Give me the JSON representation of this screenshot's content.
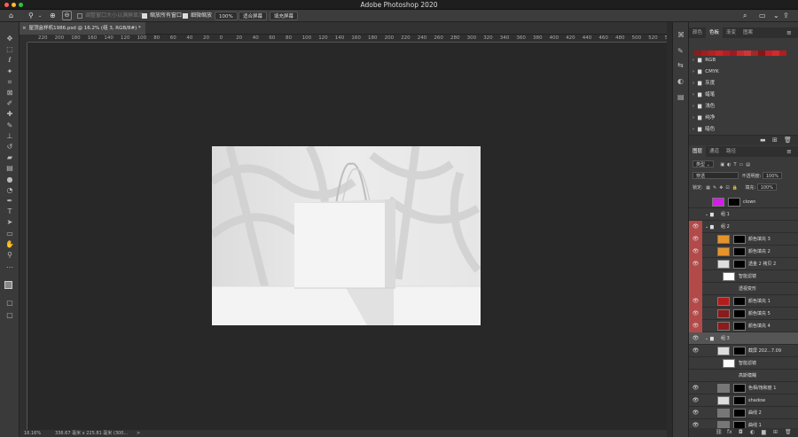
{
  "app": {
    "title": "Adobe Photoshop 2020"
  },
  "options": {
    "resize_label": "调整窗口大小以满屏显示",
    "zoom_all_label": "缩放所有窗口",
    "scrubby_label": "细微缩放",
    "zoom_value": "100%",
    "fit_screen": "适合屏幕",
    "fill_screen": "填充屏幕"
  },
  "document": {
    "tab_label": "屋顶盒样机1986.psd @ 16.2% (组 3, RGB/8#) *"
  },
  "ruler": {
    "h_ticks": [
      "220",
      "200",
      "180",
      "160",
      "140",
      "120",
      "100",
      "80",
      "60",
      "40",
      "20",
      "0",
      "20",
      "40",
      "60",
      "80",
      "100",
      "120",
      "140",
      "160",
      "180",
      "200",
      "220",
      "240",
      "260",
      "280",
      "300",
      "320",
      "340",
      "360",
      "380",
      "400",
      "420",
      "440",
      "460",
      "480",
      "500",
      "520",
      "540",
      "560"
    ]
  },
  "status": {
    "zoom": "16.16%",
    "size": "336.67 毫米 x 225.81 毫米 (300...",
    "arrow": ">"
  },
  "colors": {
    "accent_red": "#b34a4a",
    "bg": "#2b2b2b",
    "panel": "#3a3a3a"
  },
  "swatches_panel": {
    "tabs": [
      "颜色",
      "色板",
      "渐变",
      "图案"
    ],
    "active_tab": "色板",
    "swatch_colors": [
      "#8c1b1b",
      "#a11e1e",
      "#b52020",
      "#c92424",
      "#b81c26",
      "#9e1a22",
      "#c42b2b",
      "#d13636",
      "#a12828",
      "#8a1414",
      "#c61f2a",
      "#d22a2a",
      "#b01e1e"
    ],
    "folders": [
      "RGB",
      "CMYK",
      "灰度",
      "蜡笔",
      "浅色",
      "纯净",
      "暗色"
    ]
  },
  "layers_panel": {
    "tabs": [
      "图层",
      "通道",
      "路径"
    ],
    "active_tab": "图层",
    "kind_label": "类型",
    "blend_mode": "穿透",
    "opacity_label": "不透明度:",
    "opacity_value": "100%",
    "lock_label": "锁定:",
    "fill_label": "填充:",
    "fill_value": "100%",
    "layers": [
      {
        "name": "clown",
        "type": "color",
        "swatch": "#d21ee8",
        "red": false,
        "eye": false,
        "indent": 0
      },
      {
        "name": "组 1",
        "type": "group",
        "red": false,
        "eye": false,
        "indent": 0
      },
      {
        "name": "组 2",
        "type": "group",
        "red": true,
        "eye": true,
        "indent": 0
      },
      {
        "name": "颜色填充 3",
        "type": "fill",
        "swatch": "#e8932a",
        "red": true,
        "eye": true,
        "indent": 1
      },
      {
        "name": "颜色填充 2",
        "type": "fill",
        "swatch": "#e8932a",
        "red": true,
        "eye": true,
        "indent": 1
      },
      {
        "name": "透金 2 拷贝 2",
        "type": "smart",
        "red": true,
        "eye": true,
        "indent": 1
      },
      {
        "name": "智能滤镜",
        "type": "filter",
        "red": true,
        "eye": false,
        "indent": 2
      },
      {
        "name": "透视变形",
        "type": "subfilter",
        "red": true,
        "eye": false,
        "indent": 2
      },
      {
        "name": "颜色填充 1",
        "type": "fill",
        "swatch": "#b41c1c",
        "red": true,
        "eye": true,
        "indent": 1
      },
      {
        "name": "颜色填充 5",
        "type": "fill",
        "swatch": "#8c1b1b",
        "red": true,
        "eye": true,
        "indent": 1
      },
      {
        "name": "颜色填充 4",
        "type": "fill",
        "swatch": "#8c1b1b",
        "red": true,
        "eye": true,
        "indent": 1
      },
      {
        "name": "组 3",
        "type": "group",
        "red": false,
        "eye": true,
        "indent": 0,
        "selected": true
      },
      {
        "name": "截屏 202...7.09",
        "type": "smart",
        "red": false,
        "eye": true,
        "indent": 1
      },
      {
        "name": "智能滤镜",
        "type": "filter",
        "red": false,
        "eye": false,
        "indent": 2
      },
      {
        "name": "高斯模糊",
        "type": "subfilter",
        "red": false,
        "eye": false,
        "indent": 2
      },
      {
        "name": "色相/饱和度 1",
        "type": "adjust",
        "red": false,
        "eye": true,
        "indent": 1
      },
      {
        "name": "shadow",
        "type": "pixel",
        "red": false,
        "eye": true,
        "indent": 1
      },
      {
        "name": "曲线 2",
        "type": "adjust",
        "red": false,
        "eye": true,
        "indent": 1
      },
      {
        "name": "曲线 1",
        "type": "adjust",
        "red": false,
        "eye": true,
        "indent": 1
      }
    ],
    "footer_icons": [
      "link-icon",
      "fx-icon",
      "mask-icon",
      "adjust-icon",
      "folder-icon",
      "new-layer-icon",
      "trash-icon"
    ]
  },
  "tools": [
    "move-icon",
    "marquee-icon",
    "lasso-icon",
    "magic-wand-icon",
    "crop-icon",
    "frame-icon",
    "eyedropper-icon",
    "healing-icon",
    "brush-icon",
    "stamp-icon",
    "history-brush-icon",
    "eraser-icon",
    "gradient-icon",
    "blur-icon",
    "dodge-icon",
    "pen-icon",
    "type-icon",
    "path-select-icon",
    "shape-icon",
    "hand-icon",
    "zoom-icon",
    "more-icon"
  ]
}
